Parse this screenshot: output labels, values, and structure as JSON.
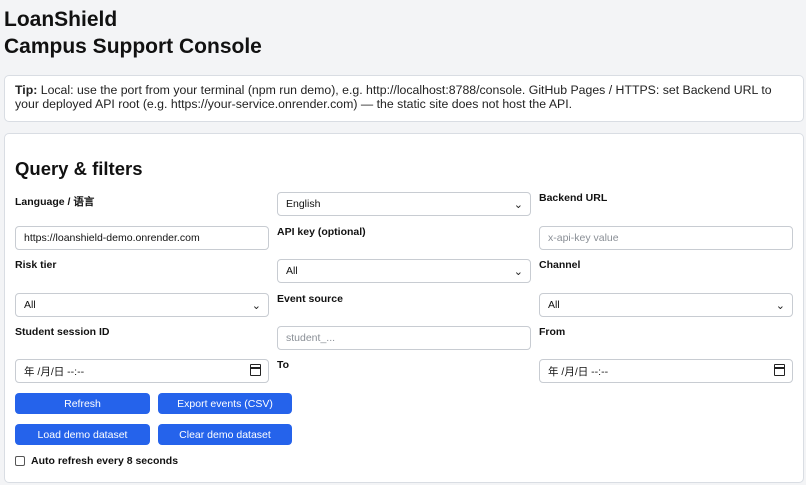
{
  "header": {
    "app_name": "LoanShield",
    "subtitle": "Campus Support Console"
  },
  "tip": {
    "prefix": "Tip:",
    "text": " Local: use the port from your terminal (npm run demo), e.g. http://localhost:8788/console. GitHub Pages / HTTPS: set Backend URL to your deployed API root (e.g. https://your-service.onrender.com) — the static site does not host the API."
  },
  "filters": {
    "title": "Query & filters",
    "language": {
      "label": "Language / 语言",
      "value": "English"
    },
    "backend_url": {
      "label": "Backend URL",
      "value": "https://loanshield-demo.onrender.com"
    },
    "api_key": {
      "label": "API key (optional)",
      "placeholder": "x-api-key value"
    },
    "risk_tier": {
      "label": "Risk tier",
      "value": "All"
    },
    "channel": {
      "label": "Channel",
      "value": "All"
    },
    "event_source": {
      "label": "Event source",
      "value": "All"
    },
    "student_session": {
      "label": "Student session ID",
      "placeholder": "student_..."
    },
    "from": {
      "label": "From",
      "value": "年 /月/日 --:--"
    },
    "to": {
      "label": "To",
      "value": "年 /月/日 --:--"
    }
  },
  "actions": {
    "refresh": "Refresh",
    "export_csv": "Export events (CSV)",
    "load_demo": "Load demo dataset",
    "clear_demo": "Clear demo dataset"
  },
  "auto_refresh": {
    "label": "Auto refresh every 8 seconds",
    "checked": false
  },
  "colors": {
    "accent": "#2563eb",
    "page_bg": "#f3f4f6",
    "card_bg": "#ffffff"
  }
}
